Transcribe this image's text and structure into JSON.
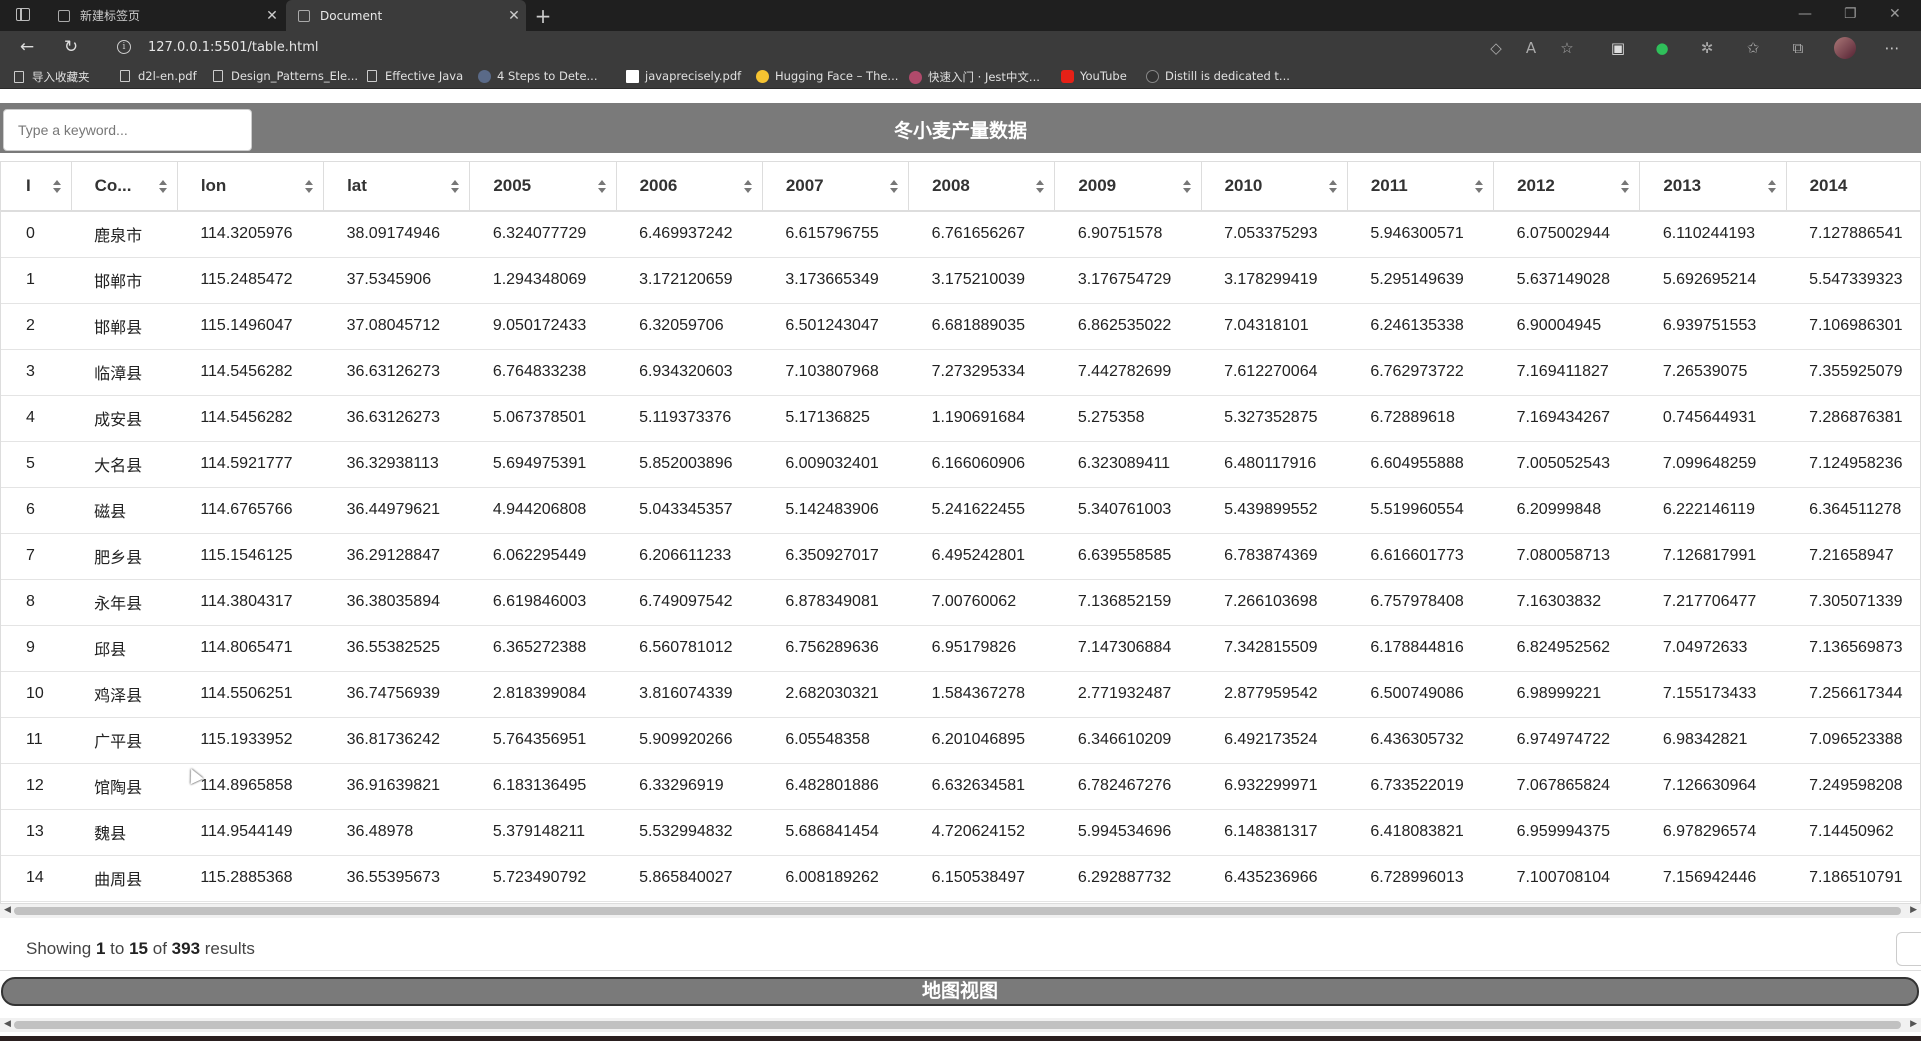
{
  "browser": {
    "tabs": [
      {
        "label": "新建标签页"
      },
      {
        "label": "Document"
      }
    ],
    "url": "127.0.0.1:5501/table.html",
    "bookmarks": [
      {
        "label": "导入收藏夹"
      },
      {
        "label": "d2l-en.pdf"
      },
      {
        "label": "Design_Patterns_Ele..."
      },
      {
        "label": "Effective Java"
      },
      {
        "label": "4 Steps to Dete..."
      },
      {
        "label": "javaprecisely.pdf"
      },
      {
        "label": "Hugging Face – The..."
      },
      {
        "label": "快速入门 · Jest中文..."
      },
      {
        "label": "YouTube"
      },
      {
        "label": "Distill is dedicated t..."
      }
    ]
  },
  "page": {
    "title": "冬小麦产量数据",
    "search_placeholder": "Type a keyword...",
    "map_button": "地图视图",
    "showing": {
      "prefix": "Showing",
      "from": "1",
      "to_word": "to",
      "to": "15",
      "of_word": "of",
      "total": "393",
      "suffix": "results"
    }
  },
  "table": {
    "columns": [
      "I",
      "Co...",
      "lon",
      "lat",
      "2005",
      "2006",
      "2007",
      "2008",
      "2009",
      "2010",
      "2011",
      "2012",
      "2013",
      "2014"
    ],
    "rows": [
      [
        "0",
        "鹿泉市",
        "114.3205976",
        "38.09174946",
        "6.324077729",
        "6.469937242",
        "6.615796755",
        "6.761656267",
        "6.90751578",
        "7.053375293",
        "5.946300571",
        "6.075002944",
        "6.110244193",
        "7.127886541"
      ],
      [
        "1",
        "邯郸市",
        "115.2485472",
        "37.5345906",
        "1.294348069",
        "3.172120659",
        "3.173665349",
        "3.175210039",
        "3.176754729",
        "3.178299419",
        "5.295149639",
        "5.637149028",
        "5.692695214",
        "5.547339323"
      ],
      [
        "2",
        "邯郸县",
        "115.1496047",
        "37.08045712",
        "9.050172433",
        "6.32059706",
        "6.501243047",
        "6.681889035",
        "6.862535022",
        "7.04318101",
        "6.246135338",
        "6.90004945",
        "6.939751553",
        "7.106986301"
      ],
      [
        "3",
        "临漳县",
        "114.5456282",
        "36.63126273",
        "6.764833238",
        "6.934320603",
        "7.103807968",
        "7.273295334",
        "7.442782699",
        "7.612270064",
        "6.762973722",
        "7.169411827",
        "7.26539075",
        "7.355925079"
      ],
      [
        "4",
        "成安县",
        "114.5456282",
        "36.63126273",
        "5.067378501",
        "5.119373376",
        "5.17136825",
        "1.190691684",
        "5.275358",
        "5.327352875",
        "6.72889618",
        "7.169434267",
        "0.745644931",
        "7.286876381"
      ],
      [
        "5",
        "大名县",
        "114.5921777",
        "36.32938113",
        "5.694975391",
        "5.852003896",
        "6.009032401",
        "6.166060906",
        "6.323089411",
        "6.480117916",
        "6.604955888",
        "7.005052543",
        "7.099648259",
        "7.124958236"
      ],
      [
        "6",
        "磁县",
        "114.6765766",
        "36.44979621",
        "4.944206808",
        "5.043345357",
        "5.142483906",
        "5.241622455",
        "5.340761003",
        "5.439899552",
        "5.519960554",
        "6.20999848",
        "6.222146119",
        "6.364511278"
      ],
      [
        "7",
        "肥乡县",
        "115.1546125",
        "36.29128847",
        "6.062295449",
        "6.206611233",
        "6.350927017",
        "6.495242801",
        "6.639558585",
        "6.783874369",
        "6.616601773",
        "7.080058713",
        "7.126817991",
        "7.21658947"
      ],
      [
        "8",
        "永年县",
        "114.3804317",
        "36.38035894",
        "6.619846003",
        "6.749097542",
        "6.878349081",
        "7.00760062",
        "7.136852159",
        "7.266103698",
        "6.757978408",
        "7.16303832",
        "7.217706477",
        "7.305071339"
      ],
      [
        "9",
        "邱县",
        "114.8065471",
        "36.55382525",
        "6.365272388",
        "6.560781012",
        "6.756289636",
        "6.95179826",
        "7.147306884",
        "7.342815509",
        "6.178844816",
        "6.824952562",
        "7.04972633",
        "7.136569873"
      ],
      [
        "10",
        "鸡泽县",
        "114.5506251",
        "36.74756939",
        "2.818399084",
        "3.816074339",
        "2.682030321",
        "1.584367278",
        "2.771932487",
        "2.877959542",
        "6.500749086",
        "6.98999221",
        "7.155173433",
        "7.256617344"
      ],
      [
        "11",
        "广平县",
        "115.1933952",
        "36.81736242",
        "5.764356951",
        "5.909920266",
        "6.05548358",
        "6.201046895",
        "6.346610209",
        "6.492173524",
        "6.436305732",
        "6.974974722",
        "6.98342821",
        "7.096523388"
      ],
      [
        "12",
        "馆陶县",
        "114.8965858",
        "36.91639821",
        "6.183136495",
        "6.33296919",
        "6.482801886",
        "6.632634581",
        "6.782467276",
        "6.932299971",
        "6.733522019",
        "7.067865824",
        "7.126630964",
        "7.249598208"
      ],
      [
        "13",
        "魏县",
        "114.9544149",
        "36.48978",
        "5.379148211",
        "5.532994832",
        "5.686841454",
        "4.720624152",
        "5.994534696",
        "6.148381317",
        "6.418083821",
        "6.959994375",
        "6.978296574",
        "7.14450962"
      ],
      [
        "14",
        "曲周县",
        "115.2885368",
        "36.55395673",
        "5.723490792",
        "5.865840027",
        "6.008189262",
        "6.150538497",
        "6.292887732",
        "6.435236966",
        "6.728996013",
        "7.100708104",
        "7.156942446",
        "7.186510791"
      ]
    ]
  }
}
